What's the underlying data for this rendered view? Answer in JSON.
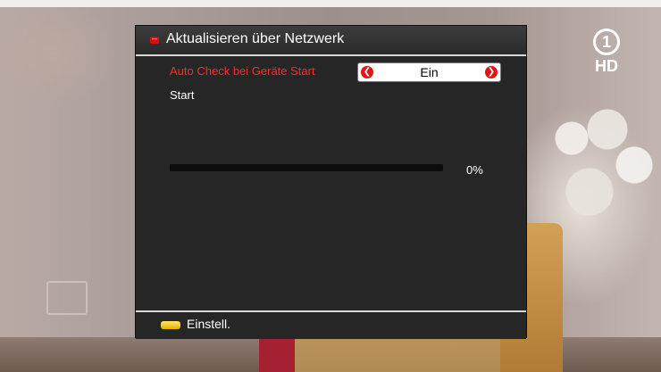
{
  "channel": {
    "logo_number": "1",
    "logo_suffix": "HD"
  },
  "dialog": {
    "title": "Aktualisieren über Netzwerk",
    "auto_check": {
      "label": "Auto Check bei Geräte Start",
      "value": "Ein"
    },
    "start_label": "Start",
    "progress": {
      "percent": 0,
      "text": "0%"
    },
    "footer": {
      "key_color": "yellow",
      "label": "Einstell."
    }
  },
  "colors": {
    "highlight_text": "#ff2a2a",
    "dialog_bg": "#262626",
    "arrow": "#e01414",
    "key_yellow": "#f0c000"
  }
}
